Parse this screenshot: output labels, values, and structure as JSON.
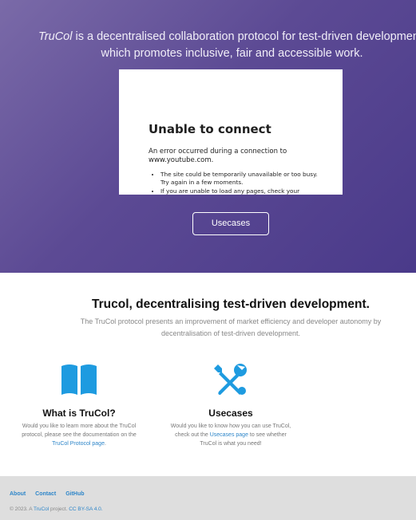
{
  "hero": {
    "brand": "TruCol",
    "tagline": " is a decentralised collaboration protocol for test-driven development, which promotes inclusive, fair and accessible work.",
    "video": {
      "error_title": "Unable to connect",
      "error_message": "An error occurred during a connection to www.youtube.com.",
      "bullets": [
        "The site could be temporarily unavailable or too busy. Try again in a few moments.",
        "If you are unable to load any pages, check your"
      ]
    },
    "button_label": "Usecases"
  },
  "intro": {
    "title": "Trucol, decentralising test-driven development.",
    "subtitle": "The TruCol protocol presents an improvement of market efficiency and developer autonomy by decentralisation of test-driven development."
  },
  "cards": [
    {
      "icon": "book-icon",
      "title": "What is TruCol?",
      "text_before": "Would you like to learn more about the TruCol protocol, please see the documentation on the ",
      "link": "TruCol Protocol page",
      "text_after": "."
    },
    {
      "icon": "tools-icon",
      "title": "Usecases",
      "text_before": "Would you like to know how you can use TruCol, check out the ",
      "link": "Usecases page",
      "text_after": " to see whether TruCol is what you need!"
    }
  ],
  "footer": {
    "links": [
      "About",
      "Contact",
      "GitHub"
    ],
    "copy_prefix": "© 2023. A ",
    "brand_link": "TruCol",
    "copy_mid": " project. ",
    "license": "CC BY-SA 4.0."
  },
  "colors": {
    "hero_gradient_start": "#7a6aa8",
    "hero_gradient_end": "#4a3a8a",
    "accent": "#2e86c9",
    "footer_bg": "#dedede"
  }
}
